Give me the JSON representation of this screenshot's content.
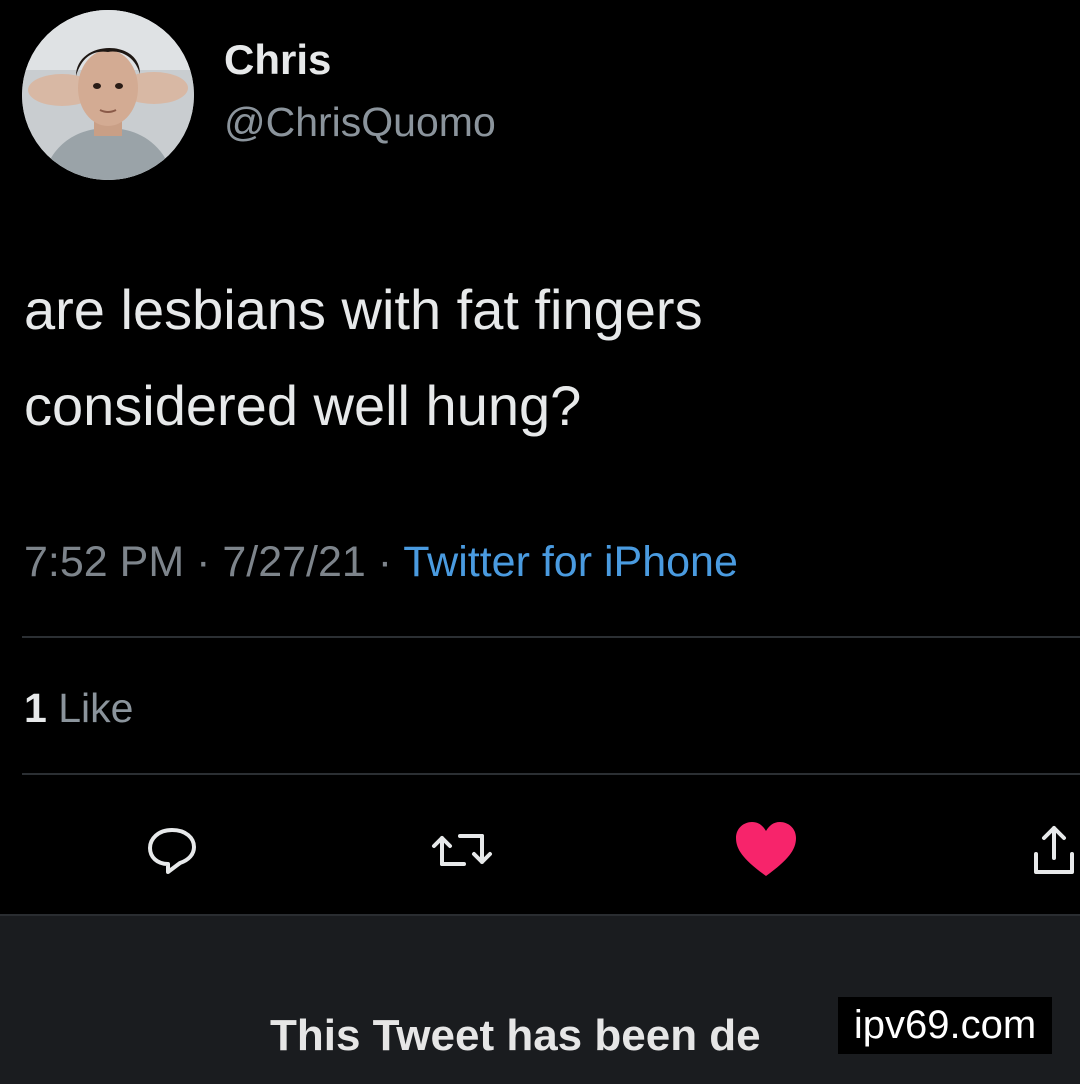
{
  "user": {
    "display_name": "Chris",
    "handle": "@ChrisQuomo"
  },
  "tweet": {
    "lines": [
      "are lesbians with fat fingers",
      "considered well hung?"
    ],
    "time": "7:52 PM",
    "date": "7/27/21",
    "separator": " · ",
    "source": "Twitter for iPhone",
    "like_count": "1",
    "like_label": " Like"
  },
  "actions": [
    {
      "name": "reply-icon"
    },
    {
      "name": "retweet-icon"
    },
    {
      "name": "heart-icon",
      "active": true
    },
    {
      "name": "share-icon"
    }
  ],
  "colors": {
    "background": "#000000",
    "link": "#4a9be0",
    "like_active": "#f7246b",
    "muted": "#7d848b"
  },
  "banner": {
    "text": "This Tweet has been de"
  },
  "watermark": {
    "text": "ipv69.com"
  }
}
